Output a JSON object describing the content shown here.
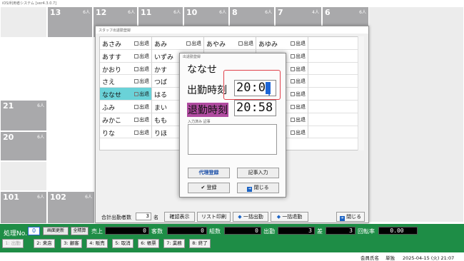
{
  "app_title": "iOS/利用者システム [ver4.3.0.7]",
  "tables": {
    "top": [
      {
        "num": "13",
        "cap": "6人"
      },
      {
        "num": "12",
        "cap": "6人"
      },
      {
        "num": "11",
        "cap": "6人"
      },
      {
        "num": "10",
        "cap": "6人"
      },
      {
        "num": "8",
        "cap": "6人"
      },
      {
        "num": "7",
        "cap": "4人"
      },
      {
        "num": "6",
        "cap": "6人"
      }
    ],
    "left": [
      {
        "num": "21",
        "cap": "6人"
      },
      {
        "num": "20",
        "cap": "6人"
      }
    ],
    "bottom": [
      {
        "num": "101",
        "cap": "6人"
      },
      {
        "num": "102",
        "cap": "6人"
      }
    ]
  },
  "staff_window": {
    "title": "スタッフ出退勤登録",
    "check_label": "出退",
    "columns": [
      [
        {
          "name": "あさみ",
          "checked": false
        },
        {
          "name": "あすす",
          "checked": false
        },
        {
          "name": "かおり",
          "checked": false
        },
        {
          "name": "さえ",
          "checked": false
        },
        {
          "name": "ななせ",
          "checked": true
        },
        {
          "name": "ふみ",
          "checked": false
        },
        {
          "name": "みかこ",
          "checked": false
        },
        {
          "name": "りな",
          "checked": false
        }
      ],
      [
        {
          "name": "あみ",
          "checked": false
        },
        {
          "name": "いずみ",
          "checked": true
        },
        {
          "name": "かす",
          "checked": false
        },
        {
          "name": "つば",
          "checked": false
        },
        {
          "name": "はる",
          "checked": false
        },
        {
          "name": "まい",
          "checked": false
        },
        {
          "name": "もも",
          "checked": false
        },
        {
          "name": "りほ",
          "checked": false
        }
      ],
      [
        {
          "name": "あやみ",
          "checked": false
        },
        {
          "name": "うゆこ",
          "checked": false
        },
        {
          "name": "",
          "checked": false
        },
        {
          "name": "",
          "checked": false
        },
        {
          "name": "",
          "checked": false
        },
        {
          "name": "",
          "checked": false
        },
        {
          "name": "",
          "checked": false
        },
        {
          "name": "",
          "checked": false
        }
      ],
      [
        {
          "name": "あゆみ",
          "checked": false
        },
        {
          "name": "えりか",
          "checked": false
        },
        {
          "name": "けい",
          "checked": false
        },
        {
          "name": "なな",
          "checked": false
        },
        {
          "name": "ふうか",
          "checked": false
        },
        {
          "name": "みか",
          "checked": false
        },
        {
          "name": "らむ",
          "checked": false
        },
        {
          "name": "れみ",
          "checked": false
        }
      ],
      [
        {
          "name": "",
          "checked": false
        },
        {
          "name": "",
          "checked": false
        },
        {
          "name": "",
          "checked": false
        },
        {
          "name": "",
          "checked": false
        },
        {
          "name": "",
          "checked": false
        },
        {
          "name": "",
          "checked": false
        },
        {
          "name": "",
          "checked": false
        },
        {
          "name": "",
          "checked": false
        }
      ]
    ],
    "footer": {
      "total_label": "合計出勤者数",
      "total_value": "3",
      "total_unit": "名",
      "confirm": "確認表示",
      "list_print": "リスト印刷",
      "bulk_in": "一括出勤",
      "bulk_out": "一括退勤",
      "close": "閉じる"
    }
  },
  "dialog": {
    "title": "出退勤登録",
    "name": "ななせ",
    "in_label": "出勤時刻",
    "in_value": "20:0",
    "out_label": "退勤時刻",
    "out_value": "20:58",
    "memo_label": "入力済み 記事",
    "memo_value": "",
    "proxy": "代理登録",
    "article": "記事入力",
    "register": "登録",
    "close": "閉じる"
  },
  "green_bar": {
    "shori_label": "処理No.",
    "shori_value": "0",
    "screen_update": "画面更新",
    "all_settle": "全精算",
    "uriage_label": "売上",
    "uriage_value": "0",
    "kyakusu_label": "客数",
    "kyakusu_value": "0",
    "kumisu_label": "組数",
    "kumisu_value": "0",
    "shukkin_label": "出勤",
    "shukkin_value": "3",
    "sa_label": "差",
    "sa_value": "3",
    "kaiten_label": "回転率",
    "kaiten_value": "0.00"
  },
  "function_keys": [
    {
      "label": "1: 出勤",
      "disabled": true
    },
    {
      "label": "2: 来店",
      "disabled": false
    },
    {
      "label": "3: 顧客",
      "disabled": false
    },
    {
      "label": "4: 販売",
      "disabled": false
    },
    {
      "label": "5: 取消",
      "disabled": false
    },
    {
      "label": "6: 帳票",
      "disabled": false
    },
    {
      "label": "7: 業務",
      "disabled": false
    },
    {
      "label": "8: 終了",
      "disabled": false
    }
  ],
  "status": {
    "member_label": "会員氏名",
    "user": "単独",
    "datetime": "2025-04-15 (火) 21:07"
  }
}
